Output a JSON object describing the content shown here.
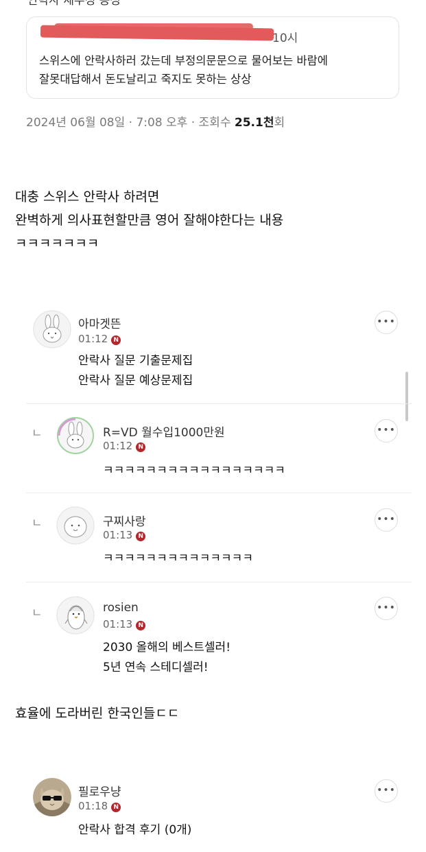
{
  "header": {
    "title": "안락사 세부정 몽성"
  },
  "quote": {
    "time": "10시",
    "lines": [
      "스위스에 안락사하러 갔는데 부정의문문으로 물어보는 바람에",
      "잘못대답해서 돈도날리고 죽지도 못하는 상상"
    ]
  },
  "meta": {
    "date": "2024년 06월 08일 · 7:08 오후 · 조회수 ",
    "views": "25.1천",
    "views_suffix": "회"
  },
  "post": {
    "lines": [
      "대충 스위스 안락사 하려면",
      "완벽하게 의사표현할만큼 영어 잘해야한다는 내용",
      "ㅋㅋㅋㅋㅋㅋㅋ"
    ],
    "middle": "효율에 도라버린 한국인들ㄷㄷ"
  },
  "comments": [
    {
      "user": "아마겟뜬",
      "time": "01:12",
      "badge": "N",
      "lines": [
        "안락사 질문 기출문제집",
        "안락사 질문 예상문제집"
      ]
    },
    {
      "user": "R=VD 월수입1000만원",
      "time": "01:12",
      "badge": "N",
      "lines": [
        "ㅋㅋㅋㅋㅋㅋㅋㅋㅋㅋㅋㅋㅋㅋㅋㅋㅋ"
      ]
    },
    {
      "user": "구찌사랑",
      "time": "01:13",
      "badge": "N",
      "lines": [
        "ㅋㅋㅋㅋㅋㅋㅋㅋㅋㅋㅋㅋㅋㅋ"
      ]
    },
    {
      "user": "rosien",
      "time": "01:13",
      "badge": "N",
      "lines": [
        "2030 올해의 베스트셀러!",
        "5년 연속 스테디셀러!"
      ]
    },
    {
      "user": "필로우냥",
      "time": "01:18",
      "badge": "N",
      "lines": [
        "안락사 합격 후기 (0개)"
      ]
    }
  ],
  "ui": {
    "more_label": "•••",
    "reply_mark": "ㄴ"
  },
  "colors": {
    "badge": "#b3262c",
    "redaction": "#e25a5a",
    "meta_gray": "#7a7a7a"
  }
}
